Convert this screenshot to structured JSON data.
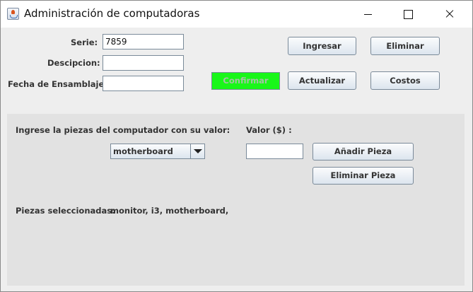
{
  "window": {
    "title": "Administración de computadoras"
  },
  "form": {
    "serie_label": "Serie:",
    "serie_value": "7859",
    "descripcion_label": "Descipcion:",
    "descripcion_value": "",
    "fecha_label": "Fecha de Ensamblaje",
    "fecha_value": ""
  },
  "buttons": {
    "ingresar": "Ingresar",
    "eliminar": "Eliminar",
    "confirmar": "Confirmar",
    "actualizar": "Actualizar",
    "costos": "Costos"
  },
  "panel": {
    "instruction": "Ingrese la piezas del computador con su valor:",
    "valor_label": "Valor ($) :",
    "pieza_selected": "motherboard",
    "valor_value": "",
    "add_button": "Añadir Pieza",
    "remove_button": "Eliminar Pieza",
    "selected_label": "Piezas seleccionadas:",
    "selected_value": "monitor, i3, motherboard,"
  },
  "colors": {
    "confirm_button_bg": "#19f719",
    "panel_bg": "#e2e2e2",
    "window_bg": "#eeeeee"
  },
  "icons": {
    "app": "java-cup-icon",
    "minimize": "minimize-icon",
    "maximize": "maximize-icon",
    "close": "close-icon",
    "dropdown": "chevron-down-icon"
  }
}
